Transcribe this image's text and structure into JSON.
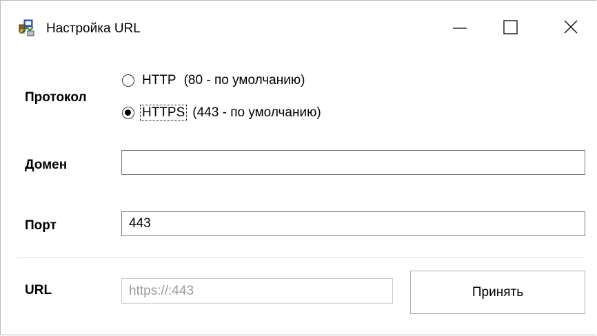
{
  "window": {
    "title": "Настройка URL",
    "icon": "url-settings-app-icon",
    "controls": {
      "minimize_icon": "minimize-icon",
      "maximize_icon": "maximize-icon",
      "close_icon": "close-icon"
    }
  },
  "protocol": {
    "label": "Протокол",
    "options": [
      {
        "main": "HTTP",
        "extra": "(80 - по умолчанию)",
        "selected": false
      },
      {
        "main": "HTTPS",
        "extra": "(443 - по умолчанию)",
        "selected": true
      }
    ]
  },
  "domain": {
    "label": "Домен",
    "value": ""
  },
  "port": {
    "label": "Порт",
    "value": "443"
  },
  "url": {
    "label": "URL",
    "value": "https://:443"
  },
  "actions": {
    "accept_label": "Принять"
  },
  "colors": {
    "border": "#7a7a7a",
    "disabled_text": "#9a9a9a",
    "button_border": "#adadad"
  }
}
